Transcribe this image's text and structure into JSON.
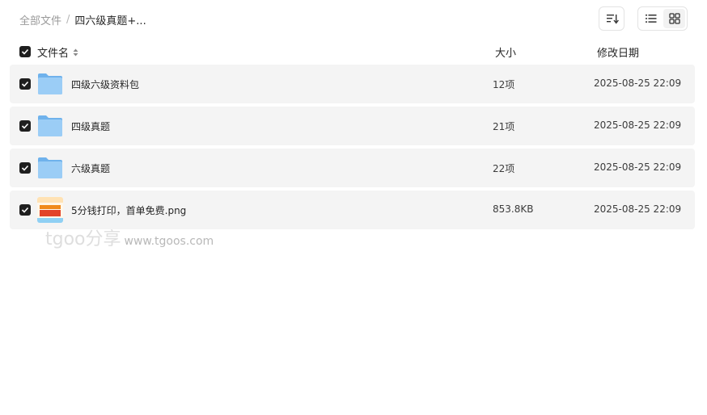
{
  "breadcrumb": {
    "root": "全部文件",
    "separator": "/",
    "current": "四六级真题+..."
  },
  "toolbar": {
    "sort_icon": "sort-lines-icon",
    "list_view_icon": "list-view-icon",
    "grid_view_icon": "grid-view-icon",
    "active_view": "list"
  },
  "columns": {
    "name": "文件名",
    "size": "大小",
    "date": "修改日期"
  },
  "files": [
    {
      "type": "folder",
      "name": "四级六级资料包",
      "size": "12项",
      "date": "2025-08-25 22:09",
      "checked": true
    },
    {
      "type": "folder",
      "name": "四级真题",
      "size": "21项",
      "date": "2025-08-25 22:09",
      "checked": true
    },
    {
      "type": "folder",
      "name": "六级真题",
      "size": "22项",
      "date": "2025-08-25 22:09",
      "checked": true
    },
    {
      "type": "image",
      "name": "5分钱打印，首单免费.png",
      "size": "853.8KB",
      "date": "2025-08-25 22:09",
      "checked": true
    }
  ],
  "watermark": {
    "logo": "tgoo分享",
    "url": "www.tgoos.com"
  },
  "colors": {
    "row_bg": "#f4f4f4",
    "checkbox": "#1f1f1f",
    "folder": "#7fbdf2"
  }
}
